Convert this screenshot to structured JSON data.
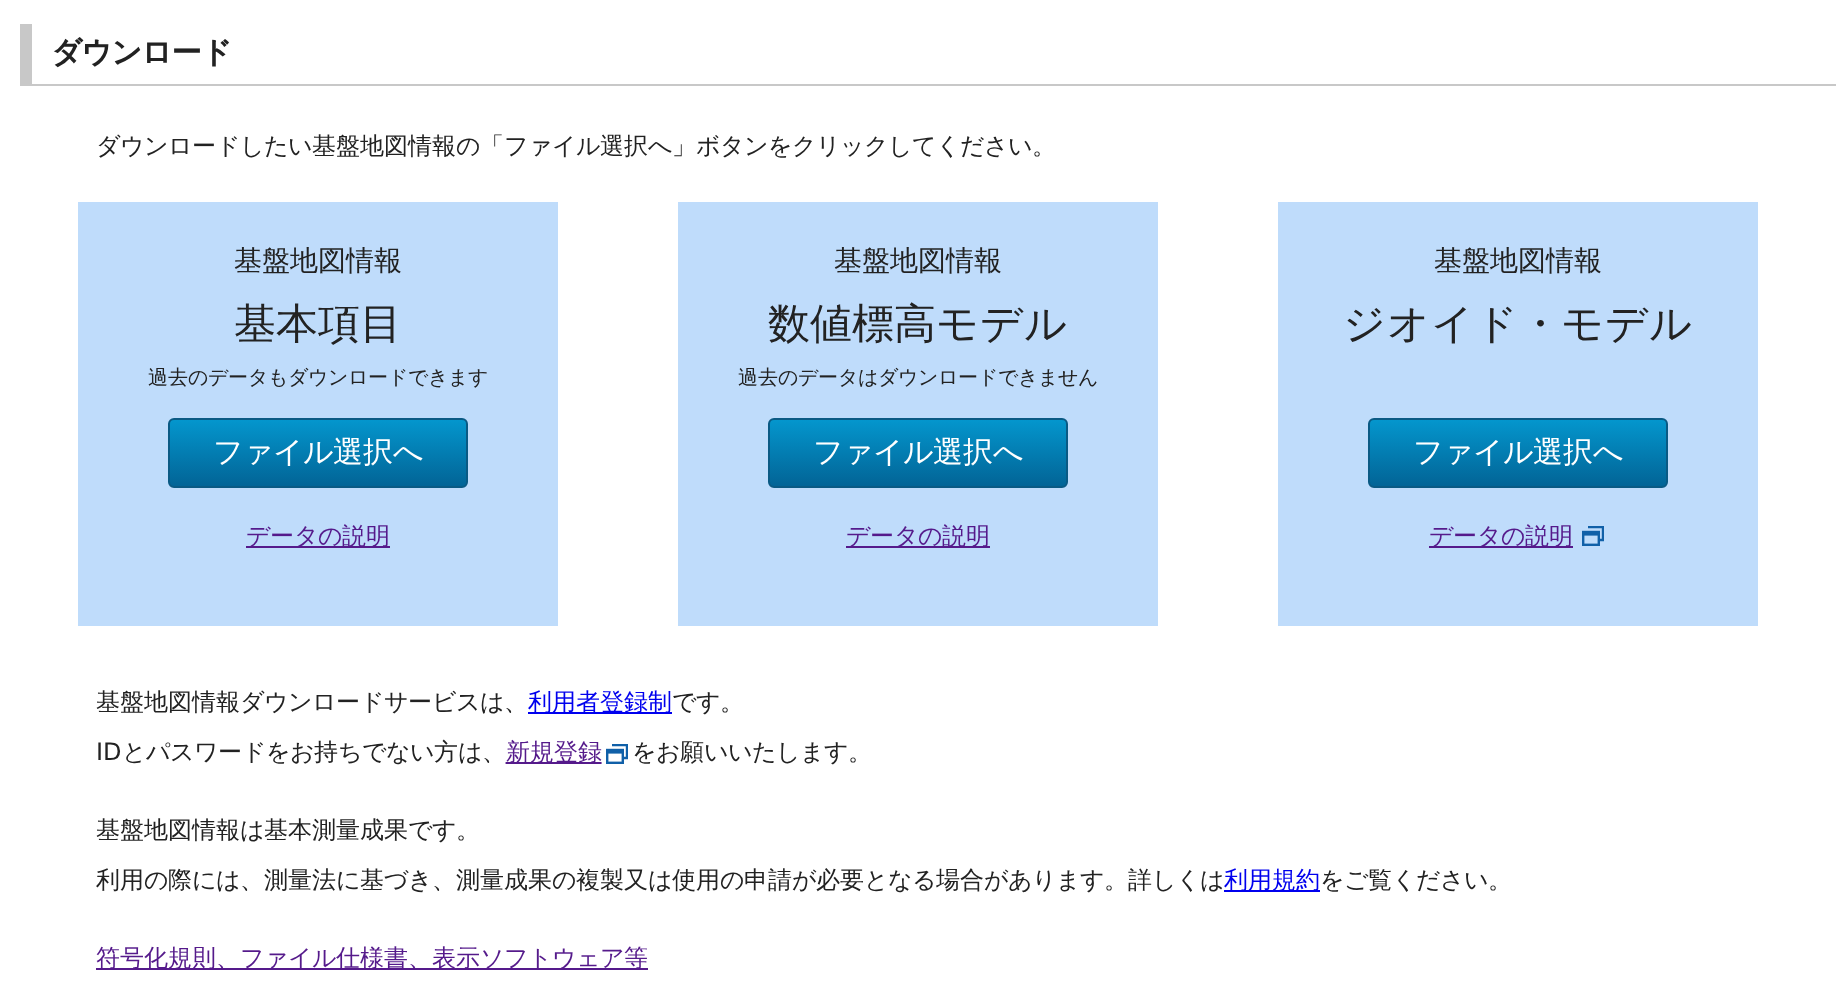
{
  "heading": "ダウンロード",
  "intro": "ダウンロードしたい基盤地図情報の「ファイル選択へ」ボタンをクリックしてください。",
  "cards": [
    {
      "label": "基盤地図情報",
      "title": "基本項目",
      "note": "過去のデータもダウンロードできます",
      "button": "ファイル選択へ",
      "link": {
        "text": "データの説明",
        "visited": true,
        "external": false
      }
    },
    {
      "label": "基盤地図情報",
      "title": "数値標高モデル",
      "note": "過去のデータはダウンロードできません",
      "button": "ファイル選択へ",
      "link": {
        "text": "データの説明",
        "visited": true,
        "external": false
      }
    },
    {
      "label": "基盤地図情報",
      "title": "ジオイド・モデル",
      "button": "ファイル選択へ",
      "link": {
        "text": "データの説明",
        "visited": true,
        "external": true
      }
    }
  ],
  "paragraphs": [
    [
      [
        {
          "kind": "text",
          "text": "基盤地図情報ダウンロードサービスは、"
        },
        {
          "kind": "link",
          "text": "利用者登録制",
          "visited": false,
          "external": false
        },
        {
          "kind": "text",
          "text": "です。"
        }
      ],
      [
        {
          "kind": "text",
          "text": "IDとパスワードをお持ちでない方は、"
        },
        {
          "kind": "link",
          "text": "新規登録",
          "visited": true,
          "external": true
        },
        {
          "kind": "text",
          "text": "をお願いいたします。"
        }
      ]
    ],
    [
      [
        {
          "kind": "text",
          "text": "基盤地図情報は基本測量成果です。"
        }
      ],
      [
        {
          "kind": "text",
          "text": "利用の際には、測量法に基づき、測量成果の複製又は使用の申請が必要となる場合があります。詳しくは"
        },
        {
          "kind": "link",
          "text": "利用規約",
          "visited": false,
          "external": false
        },
        {
          "kind": "text",
          "text": "をご覧ください。"
        }
      ]
    ],
    [
      [
        {
          "kind": "link",
          "text": "符号化規則、ファイル仕様書、表示ソフトウェア等",
          "visited": true,
          "external": false
        }
      ]
    ]
  ]
}
